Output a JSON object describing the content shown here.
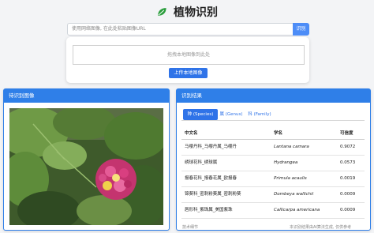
{
  "header": {
    "title": "植物识别"
  },
  "url_bar": {
    "placeholder": "使用网络图像, 在此处粘贴图像URL",
    "button": "识别"
  },
  "upload": {
    "drop_text": "拖拽本地图像到此处",
    "button": "上传本地图像"
  },
  "left_panel": {
    "title": "待识别图像"
  },
  "right_panel": {
    "title": "识别结果",
    "tabs": [
      "种 (Species)",
      "属 (Genus)",
      "科 (Family)"
    ],
    "columns": [
      "中文名",
      "学名",
      "可信度"
    ],
    "rows": [
      {
        "cn": "马缨丹科_马缨丹属_马缨丹",
        "latin": "Lantana camara",
        "conf": "0.9072"
      },
      {
        "cn": "绣球花科_绣球属",
        "latin": "Hydrangea",
        "conf": "0.0573"
      },
      {
        "cn": "报春花科_报春花属_欧报春",
        "latin": "Primula acaulis",
        "conf": "0.0019"
      },
      {
        "cn": "锦葵科_密刺粉葵属_密刺粉葵",
        "latin": "Dombeya wallichii",
        "conf": "0.0009"
      },
      {
        "cn": "唇形科_紫珠属_美国紫珠",
        "latin": "Callicarpa americana",
        "conf": "0.0009"
      }
    ],
    "footer_left": "技术细节",
    "footer_right": "本识别结果由AI算法生成, 仅供参考"
  },
  "colors": {
    "primary": "#2f7fe8",
    "leaf": "#2a9d3c"
  },
  "icons": {
    "logo": "leaf-icon"
  }
}
